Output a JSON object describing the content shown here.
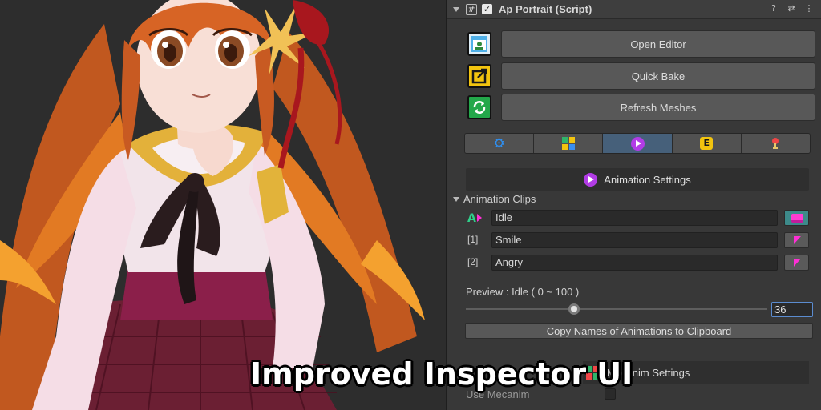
{
  "component": {
    "title": "Ap Portrait (Script)",
    "enabled": true,
    "header_icons": [
      "help-icon",
      "preset-icon",
      "context-menu-icon"
    ]
  },
  "big_buttons": [
    {
      "label": "Open Editor",
      "icon": "editor-icon",
      "icon_color": "#4fb0e8"
    },
    {
      "label": "Quick Bake",
      "icon": "bake-icon",
      "icon_color": "#f2c40f"
    },
    {
      "label": "Refresh Meshes",
      "icon": "refresh-icon",
      "icon_color": "#23a84a"
    }
  ],
  "tabs": [
    {
      "name": "settings",
      "icon": "gear-icon",
      "active": false
    },
    {
      "name": "controllers",
      "icon": "controller-icon",
      "active": false
    },
    {
      "name": "animation",
      "icon": "play-icon",
      "active": true
    },
    {
      "name": "events",
      "icon": "event-icon",
      "active": false,
      "glyph": "E"
    },
    {
      "name": "bones",
      "icon": "bone-icon",
      "active": false
    }
  ],
  "animation_section": {
    "title": "Animation Settings",
    "clips_label": "Animation Clips",
    "clips": [
      {
        "index": "",
        "name": "Idle",
        "is_default": true
      },
      {
        "index": "[1]",
        "name": "Smile",
        "is_default": false
      },
      {
        "index": "[2]",
        "name": "Angry",
        "is_default": false
      }
    ],
    "preview_label": "Preview : Idle ( 0 ~ 100 )",
    "preview_min": 0,
    "preview_max": 100,
    "preview_value": "36",
    "copy_button": "Copy Names of Animations to Clipboard"
  },
  "mecanim_section": {
    "title": "Mecanim Settings",
    "use_label": "Use Mecanim",
    "use_value": false
  },
  "caption": "Improved Inspector UI",
  "colors": {
    "accent_blue": "#46607a",
    "play_purple": "#b23ce6",
    "anim_pink": "#ff2fd6",
    "default_teal": "#3d8a8a"
  }
}
